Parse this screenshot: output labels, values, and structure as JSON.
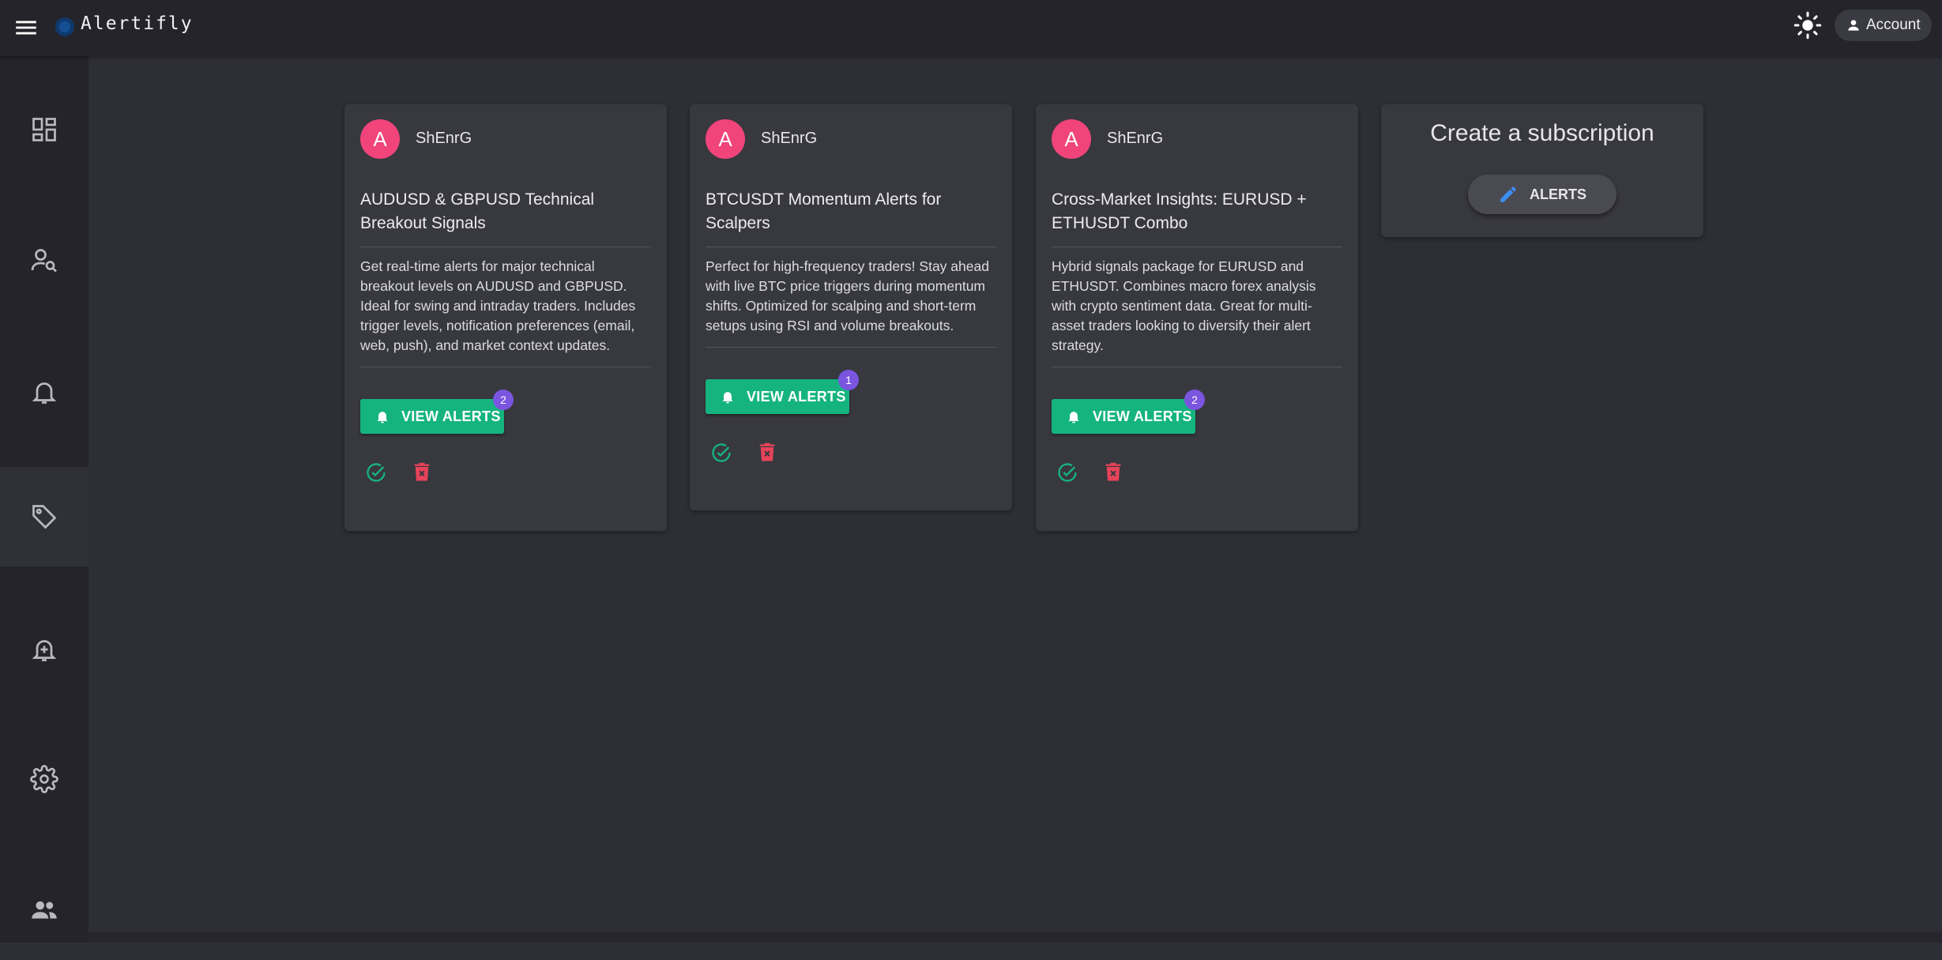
{
  "header": {
    "app_title": "Alertifly",
    "account_label": "Account"
  },
  "sidebar": {
    "items": [
      {
        "name": "dashboard",
        "icon": "dashboard-icon"
      },
      {
        "name": "user-search",
        "icon": "user-search-icon"
      },
      {
        "name": "alerts",
        "icon": "bell-icon"
      },
      {
        "name": "subscriptions",
        "icon": "tag-icon",
        "active": true
      },
      {
        "name": "add-alert",
        "icon": "bell-plus-icon"
      },
      {
        "name": "settings",
        "icon": "gear-icon"
      },
      {
        "name": "users",
        "icon": "people-icon"
      }
    ]
  },
  "cards": [
    {
      "avatar_letter": "A",
      "author": "ShEnrG",
      "title": "AUDUSD & GBPUSD Technical Breakout Signals",
      "description": "Get real-time alerts for major technical breakout levels on AUDUSD and GBPUSD. Ideal for swing and intraday traders. Includes trigger levels, notification preferences (email, web, push), and market context updates.",
      "button_label": "VIEW ALERTS",
      "badge_count": "2"
    },
    {
      "avatar_letter": "A",
      "author": "ShEnrG",
      "title": "BTCUSDT Momentum Alerts for Scalpers",
      "description": "Perfect for high-frequency traders! Stay ahead with live BTC price triggers during momentum shifts. Optimized for scalping and short-term setups using RSI and volume breakouts.",
      "button_label": "VIEW ALERTS",
      "badge_count": "1"
    },
    {
      "avatar_letter": "A",
      "author": "ShEnrG",
      "title": "Cross-Market Insights: EURUSD + ETHUSDT Combo",
      "description": "Hybrid signals package for EURUSD and ETHUSDT. Combines macro forex analysis with crypto sentiment data. Great for multi-asset traders looking to diversify their alert strategy.",
      "button_label": "VIEW ALERTS",
      "badge_count": "2"
    }
  ],
  "create_card": {
    "title": "Create a subscription",
    "button_label": "ALERTS"
  },
  "colors": {
    "background": "#2e2e36",
    "surface": "#38383f",
    "bar": "#24242a",
    "accent_green": "#15b47f",
    "avatar_pink": "#f0447b",
    "badge_purple": "#7a55e0",
    "delete_red": "#e8435a",
    "edit_blue": "#3d8ff0"
  }
}
